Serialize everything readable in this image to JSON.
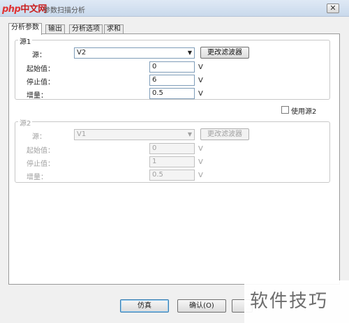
{
  "window": {
    "logo_php": "php",
    "logo_zh": "中文网",
    "title": "参数扫描分析",
    "close_glyph": "✕"
  },
  "tabs": [
    {
      "label": "分析参数"
    },
    {
      "label": "输出"
    },
    {
      "label": "分析选项"
    },
    {
      "label": "求和"
    }
  ],
  "source1": {
    "legend": "源1",
    "source_label": "源：",
    "source_value": "V2",
    "change_filter_label": "更改滤波器",
    "start_label": "起始值：",
    "start_value": "0",
    "stop_label": "停止值：",
    "stop_value": "6",
    "step_label": "增量：",
    "step_value": "0.5",
    "unit": "V"
  },
  "use_source2_label": "使用源2",
  "source2": {
    "legend": "源2",
    "source_label": "源：",
    "source_value": "V1",
    "change_filter_label": "更改滤波器",
    "start_label": "起始值：",
    "start_value": "0",
    "stop_label": "停止值：",
    "stop_value": "1",
    "step_label": "增量：",
    "step_value": "0.5",
    "unit": "V"
  },
  "footer": {
    "simulate_label": "仿真",
    "ok_label": "确认(O)"
  },
  "watermark": "软件技巧"
}
